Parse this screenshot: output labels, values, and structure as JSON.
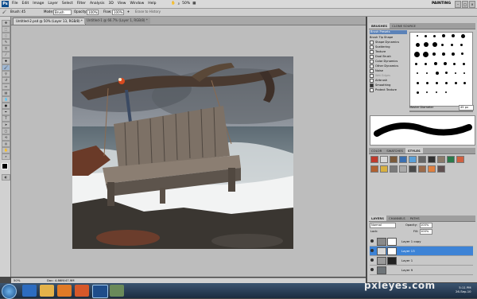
{
  "app": {
    "logo": "Ps",
    "menu": [
      "File",
      "Edit",
      "Image",
      "Layer",
      "Select",
      "Filter",
      "Analysis",
      "3D",
      "View",
      "Window",
      "Help"
    ],
    "zoom": "50%",
    "workspace": "PAINTING",
    "window_controls": [
      "–",
      "□",
      "×"
    ]
  },
  "options_bar": {
    "brush_label": "Brush:",
    "brush_size": "45",
    "mode_label": "Mode:",
    "mode_value": "Brush",
    "opacity_label": "Opacity:",
    "opacity_value": "100%",
    "flow_label": "Flow:",
    "flow_value": "100%",
    "erase_label": "Erase to History"
  },
  "tabs": [
    {
      "label": "Untitled-2.psd @ 50% (Layer 13, RGB/8) *",
      "active": true
    },
    {
      "label": "Untitled-1 @ 66.7% (Layer 1, RGB/8) *",
      "active": false
    }
  ],
  "status": {
    "zoom": "50%",
    "doc": "Doc: 4.86M/47.9M"
  },
  "brushes_panel": {
    "tabs": [
      "BRUSHES",
      "CLONE SOURCE"
    ],
    "presets_button": "Brush Presets",
    "items": [
      {
        "label": "Brush Tip Shape",
        "checked": false
      },
      {
        "label": "Shape Dynamics",
        "checked": false
      },
      {
        "label": "Scattering",
        "checked": false
      },
      {
        "label": "Texture",
        "checked": false
      },
      {
        "label": "Dual Brush",
        "checked": false
      },
      {
        "label": "Color Dynamics",
        "checked": false
      },
      {
        "label": "Other Dynamics",
        "checked": false
      },
      {
        "label": "Noise",
        "checked": false
      },
      {
        "label": "Wet Edges",
        "checked": false
      },
      {
        "label": "Airbrush",
        "checked": false
      },
      {
        "label": "Smoothing",
        "checked": true
      },
      {
        "label": "Protect Texture",
        "checked": false
      }
    ],
    "master_diameter_label": "Master Diameter",
    "master_diameter_value": "45 px"
  },
  "swatches_panel": {
    "tabs": [
      "COLOR",
      "SWATCHES",
      "STYLES"
    ],
    "colors": [
      "#c0392b",
      "#d9d9d9",
      "#7a5a3a",
      "#3a6fb0",
      "#5aa0d8",
      "#666666",
      "#333333",
      "#8a7a6a",
      "#2a7a4a",
      "#d06040",
      "#b06030",
      "#d8b040",
      "#7a7a7a",
      "#a8a8a8",
      "#4a4a4a",
      "#9a6a4a",
      "#e08040",
      "#605050"
    ]
  },
  "layers_panel": {
    "tabs": [
      "LAYERS",
      "CHANNELS",
      "PATHS"
    ],
    "blend_mode": "Normal",
    "opacity_label": "Opacity:",
    "opacity_value": "100%",
    "lock_label": "Lock:",
    "fill_label": "Fill:",
    "fill_value": "100%",
    "layers": [
      {
        "name": "Layer 1 copy",
        "selected": false
      },
      {
        "name": "Layer 13",
        "selected": true
      },
      {
        "name": "Layer 1",
        "selected": false
      },
      {
        "name": "Layer 9",
        "selected": false
      }
    ]
  },
  "taskbar": {
    "apps": [
      "ie-icon",
      "folder-icon",
      "media-player-icon",
      "firefox-icon",
      "photoshop-icon",
      "app-icon"
    ],
    "clock_time": "5:11 PM",
    "clock_date": "26-Sep-10"
  },
  "watermark": "pxleyes.com"
}
